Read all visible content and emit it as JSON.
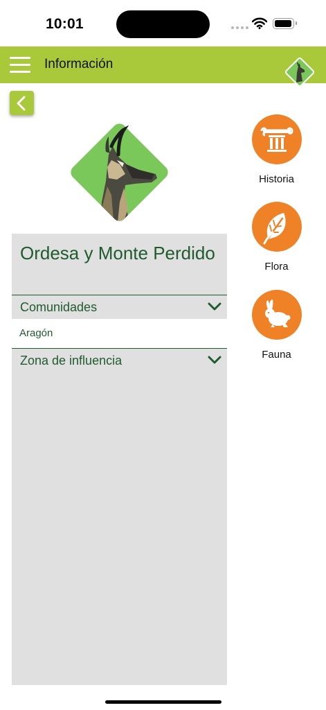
{
  "status_bar": {
    "time": "10:01"
  },
  "header": {
    "title": "Información",
    "menu_icon": "hamburger-menu-icon",
    "logo_icon": "chamois-logo-icon",
    "background_color": "#a9c93a"
  },
  "navigation": {
    "back_icon": "chevron-left-icon"
  },
  "park": {
    "name": "Ordesa y Monte Perdido",
    "logo_icon": "chamois-park-logo",
    "sections": [
      {
        "label": "Comunidades",
        "value": "Aragón",
        "expanded": true
      },
      {
        "label": "Zona de influencia",
        "expanded": false
      }
    ],
    "text_color": "#1f5b2e",
    "panel_color": "#e0e0e0"
  },
  "side_nav": {
    "accent_color": "#ef8227",
    "items": [
      {
        "label": "Historia",
        "icon": "column-icon"
      },
      {
        "label": "Flora",
        "icon": "leaf-icon"
      },
      {
        "label": "Fauna",
        "icon": "rabbit-icon"
      }
    ]
  }
}
